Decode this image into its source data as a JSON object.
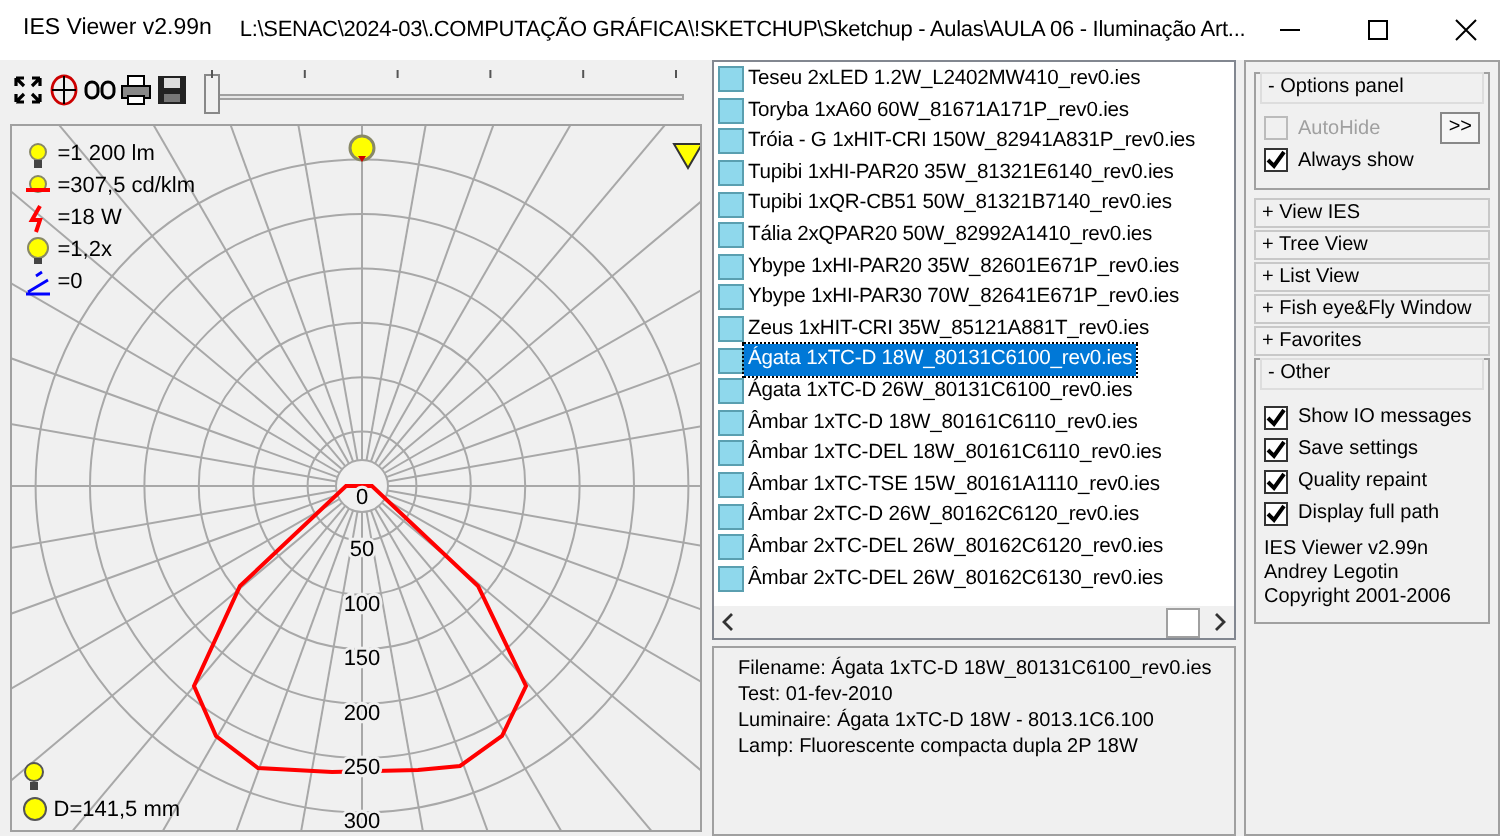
{
  "window": {
    "title": "IES Viewer v2.99n",
    "path": "L:\\SENAC\\2024-03\\.COMPUTAÇÃO GRÁFICA\\!SKETCHUP\\Sketchup - Aulas\\AULA 06 - Iluminação Art..."
  },
  "toolbar": {
    "slider": {
      "level": 0
    }
  },
  "diagram": {
    "stats": [
      {
        "kind": "lumens",
        "text": "=1 200 lm"
      },
      {
        "kind": "max",
        "text": "=307,5 cd/klm"
      },
      {
        "kind": "power",
        "text": "=18 W"
      },
      {
        "kind": "scale",
        "text": "=1,2x"
      },
      {
        "kind": "tilt",
        "text": "=0"
      }
    ],
    "ring_labels": [
      "0",
      "50",
      "100",
      "150",
      "200",
      "250",
      "300"
    ],
    "diameter": "D=141,5 mm"
  },
  "files": [
    {
      "name": "Teseu 2xLED 1.2W_L2402MW410_rev0.ies",
      "selected": false
    },
    {
      "name": "Toryba 1xA60 60W_81671A171P_rev0.ies",
      "selected": false
    },
    {
      "name": "Tróia - G 1xHIT-CRI 150W_82941A831P_rev0.ies",
      "selected": false
    },
    {
      "name": "Tupibi 1xHI-PAR20 35W_81321E6140_rev0.ies",
      "selected": false
    },
    {
      "name": "Tupibi 1xQR-CB51 50W_81321B7140_rev0.ies",
      "selected": false
    },
    {
      "name": "Tália 2xQPAR20 50W_82992A1410_rev0.ies",
      "selected": false
    },
    {
      "name": "Ybype 1xHI-PAR20 35W_82601E671P_rev0.ies",
      "selected": false
    },
    {
      "name": "Ybype 1xHI-PAR30 70W_82641E671P_rev0.ies",
      "selected": false
    },
    {
      "name": "Zeus 1xHIT-CRI 35W_85121A881T_rev0.ies",
      "selected": false
    },
    {
      "name": "Ágata 1xTC-D 18W_80131C6100_rev0.ies",
      "selected": true
    },
    {
      "name": "Ágata 1xTC-D 26W_80131C6100_rev0.ies",
      "selected": false
    },
    {
      "name": "Âmbar 1xTC-D 18W_80161C6110_rev0.ies",
      "selected": false
    },
    {
      "name": "Âmbar 1xTC-DEL 18W_80161C6110_rev0.ies",
      "selected": false
    },
    {
      "name": "Âmbar 1xTC-TSE 15W_80161A1110_rev0.ies",
      "selected": false
    },
    {
      "name": "Âmbar 2xTC-D 26W_80162C6120_rev0.ies",
      "selected": false
    },
    {
      "name": "Âmbar 2xTC-DEL 26W_80162C6120_rev0.ies",
      "selected": false
    },
    {
      "name": "Âmbar 2xTC-DEL 26W_80162C6130_rev0.ies",
      "selected": false
    }
  ],
  "info": [
    "Filename: Ágata 1xTC-D 18W_80131C6100_rev0.ies",
    "Test: 01-fev-2010",
    "Luminaire: Ágata 1xTC-D 18W - 8013.1C6.100",
    "Lamp: Fluorescente compacta dupla 2P 18W"
  ],
  "options_panel": {
    "title": "- Options panel",
    "autohide": {
      "label": "AutoHide",
      "checked": false,
      "disabled": true
    },
    "expand_button": ">>",
    "always_show": {
      "label": "Always show",
      "checked": true,
      "disabled": false
    }
  },
  "sections": [
    "+ View IES",
    "+ Tree View",
    "+ List View",
    "+ Fish eye&Fly Window",
    "+ Favorites"
  ],
  "other": {
    "title": "- Other",
    "options": [
      {
        "label": "Show IO messages",
        "checked": true
      },
      {
        "label": "Save settings",
        "checked": true
      },
      {
        "label": "Quality repaint",
        "checked": true
      },
      {
        "label": "Display full path",
        "checked": true
      }
    ],
    "about": [
      "IES Viewer v2.99n",
      "Andrey Legotin",
      "Copyright 2001-2006"
    ]
  }
}
